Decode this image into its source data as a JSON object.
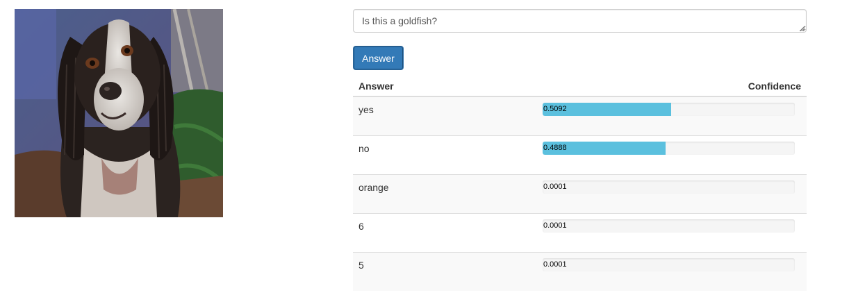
{
  "image": {
    "subject": "dog-photo"
  },
  "question": {
    "value": "Is this a goldfish?"
  },
  "submit": {
    "label": "Answer"
  },
  "table": {
    "headers": {
      "answer": "Answer",
      "confidence": "Confidence"
    },
    "rows": [
      {
        "answer": "yes",
        "confidence": 0.5092,
        "confidence_text": "0.5092"
      },
      {
        "answer": "no",
        "confidence": 0.4888,
        "confidence_text": "0.4888"
      },
      {
        "answer": "orange",
        "confidence": 0.0001,
        "confidence_text": "0.0001"
      },
      {
        "answer": "6",
        "confidence": 0.0001,
        "confidence_text": "0.0001"
      },
      {
        "answer": "5",
        "confidence": 0.0001,
        "confidence_text": "0.0001"
      }
    ]
  },
  "colors": {
    "button": "#337ab7",
    "bar_fill": "#5bc0de",
    "bar_track": "#f5f5f5"
  }
}
